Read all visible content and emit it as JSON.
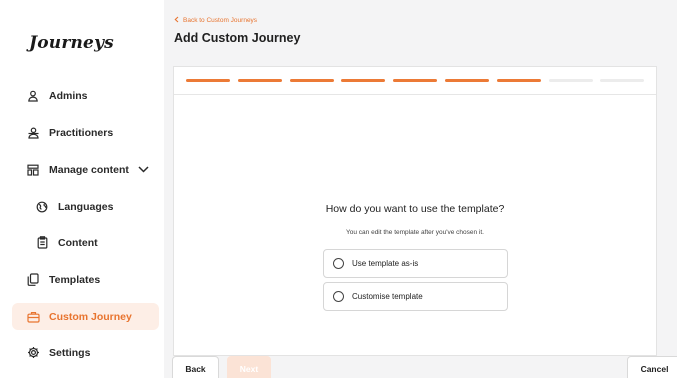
{
  "sidebar": {
    "logo": "Journeys",
    "items": [
      {
        "label": "Admins",
        "icon": "user-icon"
      },
      {
        "label": "Practitioners",
        "icon": "users-icon"
      },
      {
        "label": "Manage content",
        "icon": "layout-icon"
      },
      {
        "label": "Languages",
        "icon": "globe-icon"
      },
      {
        "label": "Content",
        "icon": "clipboard-icon"
      },
      {
        "label": "Templates",
        "icon": "copy-icon"
      },
      {
        "label": "Custom Journey",
        "icon": "briefcase-icon",
        "active": true
      },
      {
        "label": "Settings",
        "icon": "gear-icon"
      }
    ]
  },
  "header": {
    "back_link": "Back to Custom Journeys",
    "title": "Add Custom Journey"
  },
  "progress": {
    "steps_total": 9,
    "steps_completed": 7
  },
  "form": {
    "question": "How do you want to use the template?",
    "hint": "You can edit the template after you've chosen it.",
    "options": [
      {
        "label": "Use template as-is"
      },
      {
        "label": "Customise template"
      }
    ]
  },
  "footer": {
    "back_label": "Back",
    "next_label": "Next",
    "cancel_label": "Cancel"
  },
  "colors": {
    "accent": "#ec7a36",
    "active_bg": "#fdeee6",
    "main_bg": "#f4f4f5"
  }
}
